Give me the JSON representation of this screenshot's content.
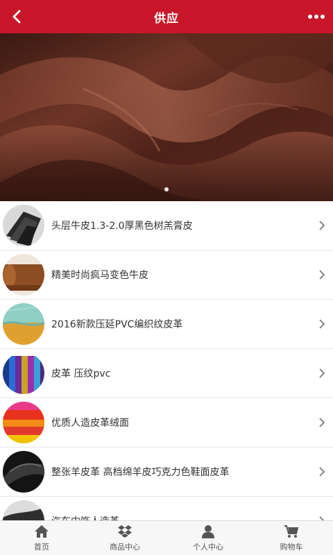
{
  "header": {
    "title": "供应",
    "back_icon": "chevron-left-icon",
    "more_icon": "more-dots-icon",
    "bg_color": "#c8172a"
  },
  "banner": {
    "description_icon": "leather-photo",
    "slide_count": 1,
    "active_slide": 1
  },
  "products": [
    {
      "title": "头层牛皮1.3-2.0厚黑色树羔膏皮"
    },
    {
      "title": "精美时尚疯马变色牛皮"
    },
    {
      "title": "2016新款压延PVC编织纹皮革"
    },
    {
      "title": "皮革 压纹pvc"
    },
    {
      "title": "优质人造皮革绒面"
    },
    {
      "title": "整张羊皮革 高档绵羊皮巧克力色鞋面皮革"
    },
    {
      "title": "汽车内饰人造革"
    }
  ],
  "tabbar": {
    "items": [
      {
        "label": "首页",
        "icon": "home-icon"
      },
      {
        "label": "商品中心",
        "icon": "dropbox-icon"
      },
      {
        "label": "个人中心",
        "icon": "user-icon"
      },
      {
        "label": "购物车",
        "icon": "cart-icon"
      }
    ]
  }
}
